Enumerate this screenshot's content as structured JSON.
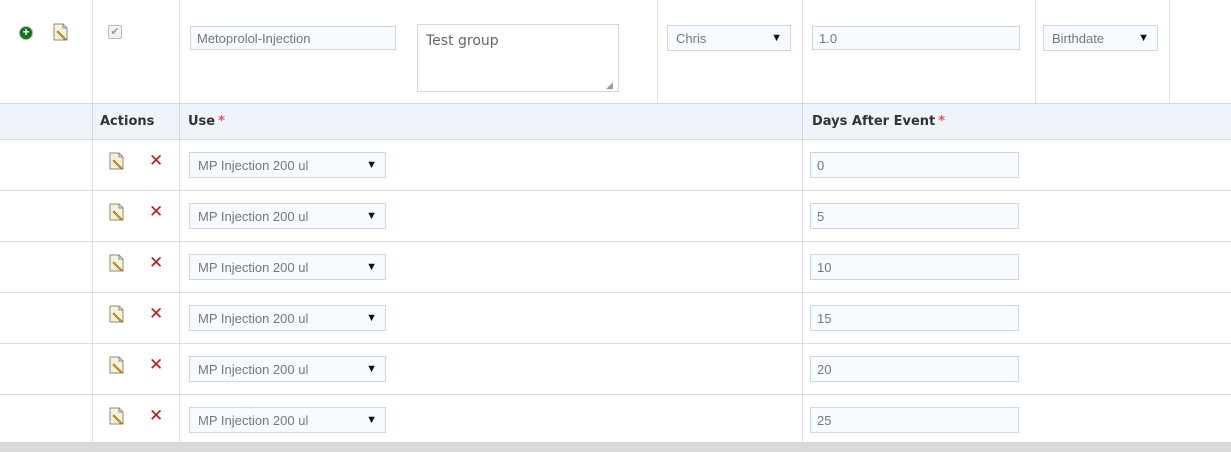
{
  "top_row": {
    "checkbox_checked": true,
    "name_value": "Metoprolol-Injection",
    "description_value": "Test group",
    "person_selected": "Chris",
    "version_value": "1.0",
    "event_selected": "Birthdate"
  },
  "table": {
    "headers": {
      "actions": "Actions",
      "use": "Use",
      "days_after_event": "Days After Event"
    },
    "required_mark": "*",
    "rows": [
      {
        "use": "MP Injection 200 ul",
        "days": "0"
      },
      {
        "use": "MP Injection 200 ul",
        "days": "5"
      },
      {
        "use": "MP Injection 200 ul",
        "days": "10"
      },
      {
        "use": "MP Injection 200 ul",
        "days": "15"
      },
      {
        "use": "MP Injection 200 ul",
        "days": "20"
      },
      {
        "use": "MP Injection 200 ul",
        "days": "25"
      }
    ]
  },
  "icons": {
    "add": "add-circle-icon",
    "edit": "edit-pencil-icon",
    "delete": "delete-x-icon",
    "dropdown": "dropdown-arrow-icon",
    "checkbox": "checkmark-icon"
  },
  "colors": {
    "header_band": "#eef4fa",
    "delete": "#c2151b",
    "required": "#e05656",
    "add": "#1d6b25"
  }
}
